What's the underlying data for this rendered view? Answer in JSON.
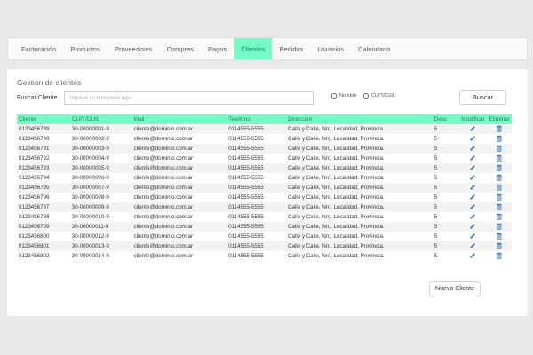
{
  "nav": {
    "items": [
      "Facturación",
      "Productos",
      "Proveedores",
      "Compras",
      "Pagos",
      "Clientes",
      "Pedidos",
      "Usuarios",
      "Calendario"
    ],
    "active": "Clientes"
  },
  "panel": {
    "title": "Gestion de clientes",
    "search_label": "Buscar Cliente",
    "search_placeholder": "Ingrese su busqueda aqui",
    "check_nombre": "Nombre",
    "check_cuit": "CUIT/CUIL",
    "search_button": "Buscar",
    "new_button": "Nuevo Cliente"
  },
  "table": {
    "headers": [
      "Cliente",
      "CUIT/CUIL",
      "Mail",
      "Telefono",
      "Direccion",
      "Desc",
      "Modificar",
      "Eliminar"
    ],
    "rows": [
      [
        "0123456789",
        "30-00000001-9",
        "cliente@dominio.com.ar",
        "0114555-5555",
        "Calle y Calle, Nro, Localidad, Provincia.",
        "5"
      ],
      [
        "0123456790",
        "30-00000002-9",
        "cliente@dominio.com.ar",
        "0114555-5555",
        "Calle y Calle, Nro, Localidad, Provincia.",
        "5"
      ],
      [
        "0123456791",
        "30-00000003-9",
        "cliente@dominio.com.ar",
        "0114555-5555",
        "Calle y Calle, Nro, Localidad, Provincia.",
        "5"
      ],
      [
        "0123456792",
        "30-00000004-9",
        "cliente@dominio.com.ar",
        "0114555-5555",
        "Calle y Calle, Nro, Localidad, Provincia.",
        "5"
      ],
      [
        "0123456793",
        "30-00000005-9",
        "cliente@dominio.com.ar",
        "0114555-5555",
        "Calle y Calle, Nro, Localidad, Provincia.",
        "5"
      ],
      [
        "0123456794",
        "30-00000006-9",
        "cliente@dominio.com.ar",
        "0114555-5555",
        "Calle y Calle, Nro, Localidad, Provincia.",
        "5"
      ],
      [
        "0123456795",
        "30-00000007-9",
        "cliente@dominio.com.ar",
        "0114555-5555",
        "Calle y Calle, Nro, Localidad, Provincia.",
        "5"
      ],
      [
        "0123456796",
        "30-00000008-9",
        "cliente@dominio.com.ar",
        "0114555-5555",
        "Calle y Calle, Nro, Localidad, Provincia.",
        "5"
      ],
      [
        "0123456797",
        "30-00000009-9",
        "cliente@dominio.com.ar",
        "0114555-5555",
        "Calle y Calle, Nro, Localidad, Provincia.",
        "5"
      ],
      [
        "0123456798",
        "30-00000010-9",
        "cliente@dominio.com.ar",
        "0114555-5555",
        "Calle y Calle, Nro, Localidad, Provincia.",
        "5"
      ],
      [
        "0123456799",
        "30-00000011-9",
        "cliente@dominio.com.ar",
        "0114555-5555",
        "Calle y Calle, Nro, Localidad, Provincia.",
        "5"
      ],
      [
        "0123456800",
        "30-00000012-9",
        "cliente@dominio.com.ar",
        "0114555-5555",
        "Calle y Calle, Nro, Localidad, Provincia.",
        "5"
      ],
      [
        "0123456801",
        "30-00000013-9",
        "cliente@dominio.com.ar",
        "0114555-5555",
        "Calle y Calle, Nro, Localidad, Provincia.",
        "5"
      ],
      [
        "0123456802",
        "30-00000014-9",
        "cliente@dominio.com.ar",
        "0114555-5555",
        "Calle y Calle, Nro, Localidad, Provincia.",
        "5"
      ]
    ]
  },
  "icons": {
    "edit": "pencil-icon",
    "delete": "trash-icon"
  },
  "colors": {
    "accent": "#74fbc6",
    "accent_text": "#2b7a5a",
    "icon": "#2f6fb0"
  }
}
